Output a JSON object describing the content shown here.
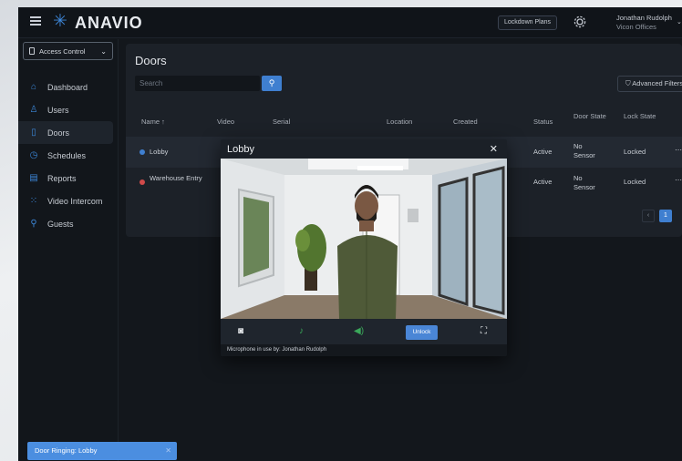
{
  "brand": {
    "name": "ANAVIO",
    "mark": "✳"
  },
  "topbar": {
    "lockdown_label": "Lockdown Plans",
    "user_name": "Jonathan Rudolph",
    "user_org": "Vicon Offices"
  },
  "sidebar": {
    "select_value": "Access Control",
    "items": [
      {
        "label": "Dashboard",
        "icon": "home-icon"
      },
      {
        "label": "Users",
        "icon": "user-icon"
      },
      {
        "label": "Doors",
        "icon": "door-icon"
      },
      {
        "label": "Schedules",
        "icon": "clock-icon"
      },
      {
        "label": "Reports",
        "icon": "report-icon"
      },
      {
        "label": "Video Intercom",
        "icon": "keypad-icon"
      },
      {
        "label": "Guests",
        "icon": "guest-icon"
      }
    ],
    "active_index": 2
  },
  "doors": {
    "title": "Doors",
    "search_placeholder": "Search",
    "advanced_filters_label": "Advanced Filters",
    "columns": {
      "name": "Name ↑",
      "video": "Video",
      "serial": "Serial",
      "location": "Location",
      "created": "Created",
      "status": "Status",
      "door_state": "Door State",
      "lock_state": "Lock State"
    },
    "rows": [
      {
        "name": "Lobby",
        "status": "Active",
        "door_state": "No Sensor",
        "lock_state": "Locked",
        "dot_color": "#3f7fd0"
      },
      {
        "name": "Warehouse Entry",
        "status": "Active",
        "door_state": "No Sensor",
        "lock_state": "Locked",
        "dot_color": "#d04a4a"
      }
    ],
    "pager": {
      "prev": "‹",
      "current": "1"
    }
  },
  "modal": {
    "title": "Lobby",
    "close": "✕",
    "unlock_label": "Unlock",
    "mic_note": "Microphone in use by: Jonathan Rudolph"
  },
  "toast": {
    "text": "Door Ringing: Lobby",
    "close": "✕"
  }
}
